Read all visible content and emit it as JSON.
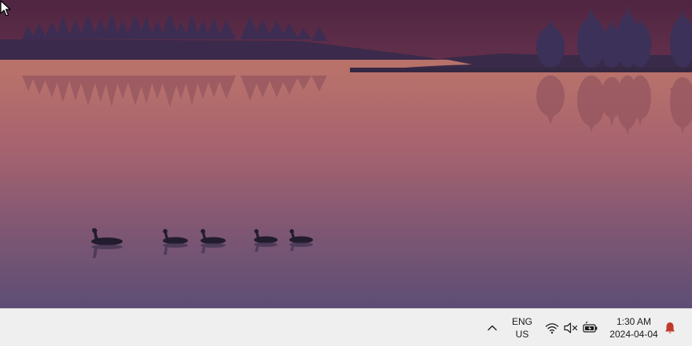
{
  "desktop": {
    "wallpaper": "sunset-lake-with-geese",
    "colors": {
      "sky_top": "#4f2541",
      "sky_bottom": "#5a2d48",
      "far_shore": "#3a2a4a",
      "water_top": "#b87068",
      "water_bottom": "#5e4e74",
      "trees": "#3f3358",
      "geese": "#1f1a2a"
    }
  },
  "taskbar": {
    "tray_chevron_icon": "chevron-up-icon",
    "language": {
      "line1": "ENG",
      "line2": "US"
    },
    "system_icons": [
      "wifi-icon",
      "speaker-muted-icon",
      "battery-charging-icon"
    ],
    "clock": {
      "time": "1:30 AM",
      "date": "2024-04-04"
    },
    "notification_icon": "bell-icon",
    "notification_color": "#c0392b"
  }
}
